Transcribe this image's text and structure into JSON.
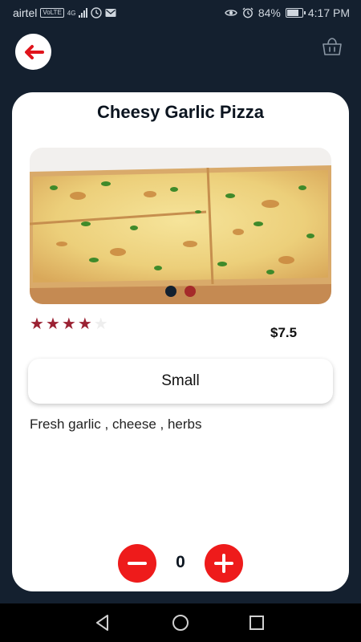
{
  "status_bar": {
    "carrier": "airtel",
    "volte": "VoLTE",
    "network": "4G",
    "battery": "84%",
    "time": "4:17 PM"
  },
  "header": {
    "back_icon": "arrow-left-icon",
    "cart_icon": "shopping-basket-icon"
  },
  "product": {
    "name": "Cheesy Garlic Pizza",
    "image_count": 2,
    "active_image": 1,
    "rating": 4,
    "rating_max": 5,
    "price": "$7.5",
    "size": "Small",
    "description": "Fresh garlic , cheese , herbs",
    "quantity": "0"
  },
  "colors": {
    "background": "#14202f",
    "accent_red": "#ee1b1b",
    "star": "#9b2233",
    "dot_active": "#14202f",
    "dot_inactive": "#a52a2a"
  },
  "nav": {
    "back": "triangle-back-icon",
    "home": "circle-home-icon",
    "recents": "square-recents-icon"
  }
}
